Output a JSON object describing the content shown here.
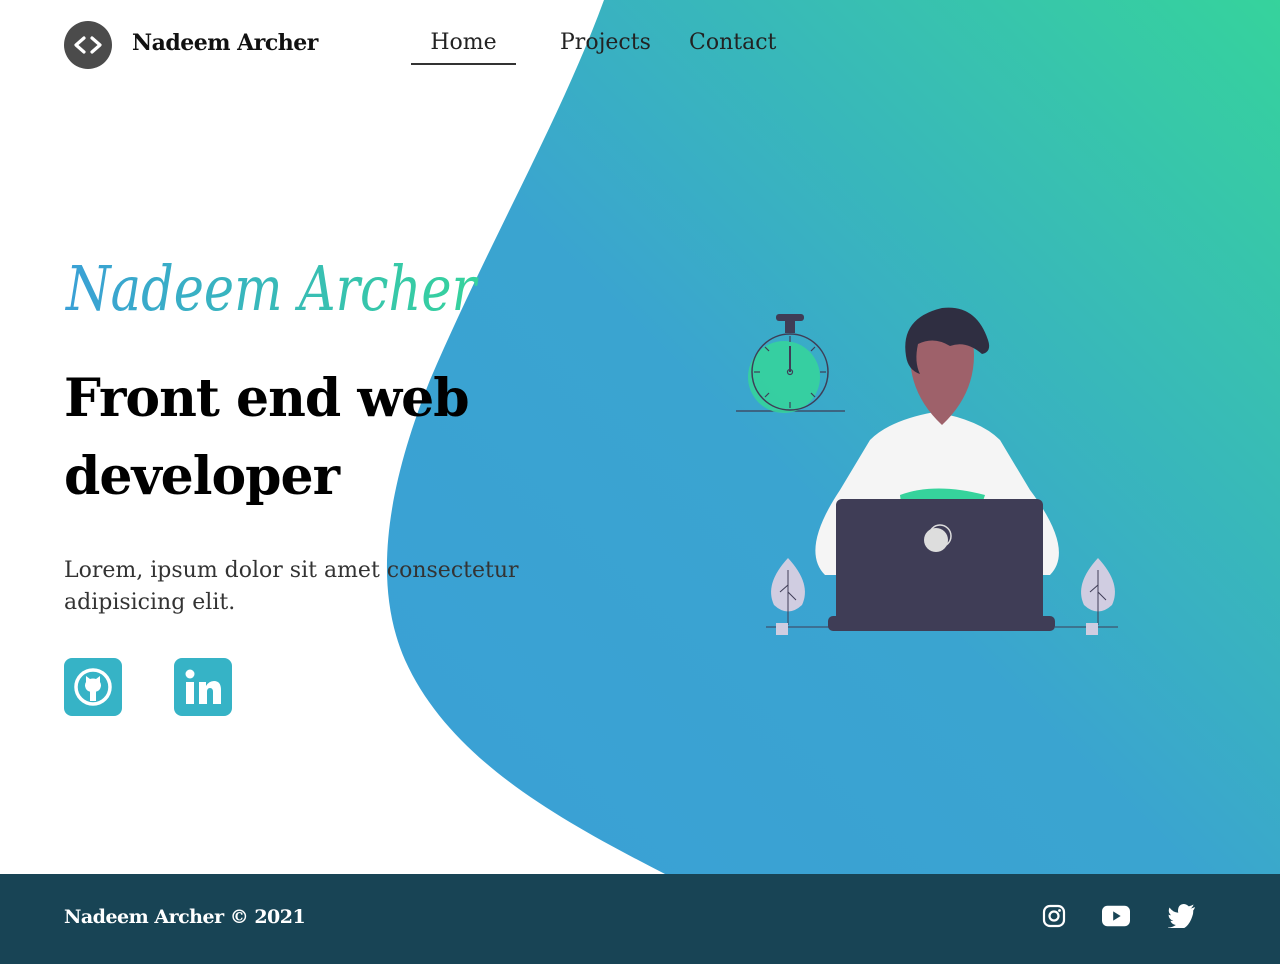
{
  "header": {
    "brand": "Nadeem Archer",
    "logo_icon": "code-brackets-icon",
    "nav": [
      {
        "label": "Home",
        "active": true
      },
      {
        "label": "Projects",
        "active": false
      },
      {
        "label": "Contact",
        "active": false
      }
    ]
  },
  "hero": {
    "script_name": "Nadeem Archer",
    "headline_line1": "Front end web",
    "headline_line2": "developer",
    "description": "Lorem, ipsum dolor sit amet consectetur adipisicing elit.",
    "social": [
      {
        "icon": "github-icon"
      },
      {
        "icon": "linkedin-icon"
      }
    ]
  },
  "footer": {
    "copyright": "Nadeem Archer © 2021",
    "social": [
      {
        "icon": "instagram-icon"
      },
      {
        "icon": "youtube-icon"
      },
      {
        "icon": "twitter-icon"
      }
    ]
  },
  "colors": {
    "gradient_start": "#3aa0d6",
    "gradient_end": "#36d39c",
    "social_square": "#36b3c6",
    "footer_bg": "#184455"
  }
}
